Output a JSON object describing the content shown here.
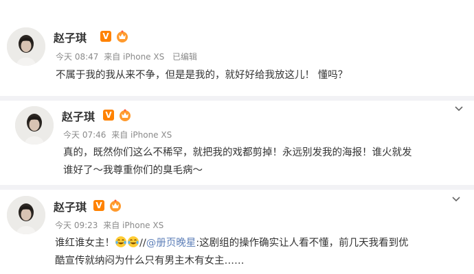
{
  "posts": [
    {
      "author": "赵子琪",
      "verified_badge": "V",
      "time": "今天 08:47",
      "source": "来自 iPhone XS",
      "edited": "已编辑",
      "text_lines": [
        "不属于我的我从来不争，但是是我的，就好好给我放这儿！ 懂吗？"
      ]
    },
    {
      "author": "赵子琪",
      "verified_badge": "V",
      "time": "今天 07:46",
      "source": "来自 iPhone XS",
      "text_lines": [
        "真的，既然你们这么不稀罕，就把我的戏都剪掉！永远别发我的海报！谁火就发",
        "谁好了～我尊重你们的臭毛病～"
      ]
    },
    {
      "author": "赵子琪",
      "verified_badge": "V",
      "time": "今天 09:23",
      "source": "来自 iPhone XS",
      "text_prefix": "谁红谁女主！",
      "text_sep": "//",
      "mention": "@册页晚星",
      "text_after_mention": ":这剧组的操作确实让人看不懂，前几天我看到优",
      "text_line2": "酷宣传就纳闷为什么只有男主木有女主……"
    }
  ],
  "icons": {
    "verified": "verified-v-icon",
    "vip": "vip-crown-icon",
    "more": "chevron-down-icon",
    "emoji": "laughing-tears-emoji"
  },
  "colors": {
    "badge": "#ff8200",
    "mention": "#5d7fb8",
    "meta": "#8a8a8a"
  }
}
